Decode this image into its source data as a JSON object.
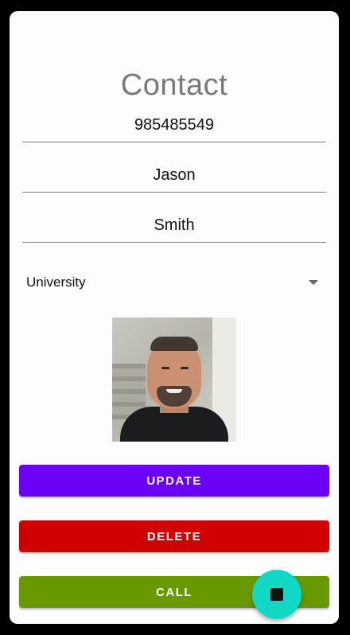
{
  "header": {
    "title": "Contact"
  },
  "form": {
    "phone": "985485549",
    "first_name": "Jason",
    "last_name": "Smith",
    "category": {
      "selected": "University"
    }
  },
  "buttons": {
    "update": "UPDATE",
    "delete": "DELETE",
    "call": "CALL"
  },
  "colors": {
    "update": "#6a00f4",
    "delete": "#d10000",
    "call": "#689a00",
    "fab": "#11d8c4"
  },
  "icons": {
    "fab": "stop-icon",
    "dropdown": "dropdown-arrow-icon"
  }
}
